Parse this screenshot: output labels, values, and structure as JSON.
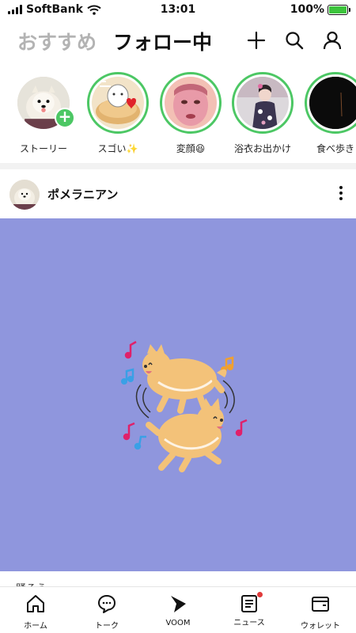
{
  "status_bar": {
    "carrier": "SoftBank",
    "time": "13:01",
    "battery": "100%",
    "battery_level": 1.0
  },
  "header": {
    "tab_recommend": "おすすめ",
    "tab_following": "フォロー中",
    "icons": [
      "plus-icon",
      "search-icon",
      "profile-icon"
    ]
  },
  "stories": [
    {
      "label": "ストーリー",
      "has_add_badge": true
    },
    {
      "label": "スゴい✨"
    },
    {
      "label": "変顔😆"
    },
    {
      "label": "浴衣お出かけ"
    },
    {
      "label": "食べ歩き"
    }
  ],
  "post": {
    "author": "ポメラニアン",
    "caption": "踊ろう"
  },
  "colors": {
    "accent_green": "#4cc764",
    "media_background": "#8f96dd",
    "notification_red": "#e03a3a"
  },
  "bottom_nav": [
    {
      "label": "ホーム",
      "icon": "home-icon"
    },
    {
      "label": "トーク",
      "icon": "chat-icon"
    },
    {
      "label": "VOOM",
      "icon": "voom-icon"
    },
    {
      "label": "ニュース",
      "icon": "news-icon"
    },
    {
      "label": "ウォレット",
      "icon": "wallet-icon"
    }
  ]
}
